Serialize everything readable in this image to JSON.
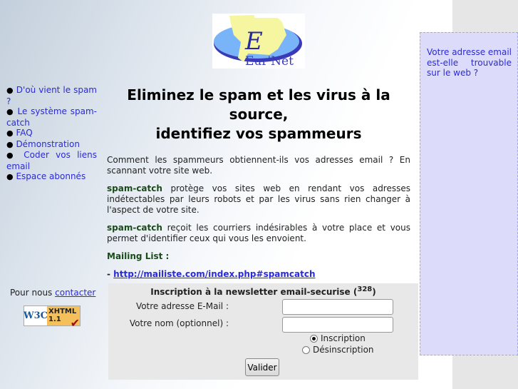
{
  "logo": {
    "text": "Eur'Net",
    "letter": "E"
  },
  "nav": [
    {
      "label": "D'où vient le spam ?"
    },
    {
      "label": "Le système spam-catch"
    },
    {
      "label": "FAQ"
    },
    {
      "label": "Démonstration"
    },
    {
      "label": "Coder vos liens email"
    },
    {
      "label": "Espace abonnés"
    }
  ],
  "contact": {
    "prefix": "Pour nous",
    "link": "contacter"
  },
  "badge": {
    "w3c": "W3C",
    "xhtml": "XHTML",
    "version": "1.1"
  },
  "main": {
    "title_line1": "Eliminez le spam et les virus à la source,",
    "title_line2": "identifiez vos spammeurs",
    "p1": "Comment les spammeurs obtiennent-ils vos adresses email ? En scannant votre site web.",
    "brand": "spam-catch",
    "p2": " protège vos sites web en rendant vos adresses indétectables par leurs robots et par les virus sans rien changer à l'aspect de votre site.",
    "p3": " reçoit les courriers indésirables à votre place et vous permet d'identifier ceux qui vous les envoient.",
    "mailing_label": "Mailing List :",
    "mailing_dash": "- ",
    "mailing_link": "http://mailiste.com/index.php#spamcatch"
  },
  "form": {
    "title": "Inscription à la newsletter email-securise (",
    "count": "328",
    "title_end": ")",
    "email_label": "Votre adresse E-Mail :",
    "email_value": "",
    "name_label": "Votre nom (optionnel) :",
    "name_value": "",
    "radio_subscribe": "Inscription",
    "radio_unsubscribe": "Désinscription",
    "selected": "Inscription",
    "submit": "Valider"
  },
  "side": {
    "text": "Votre adresse email est-elle trouvable sur le web ?"
  }
}
